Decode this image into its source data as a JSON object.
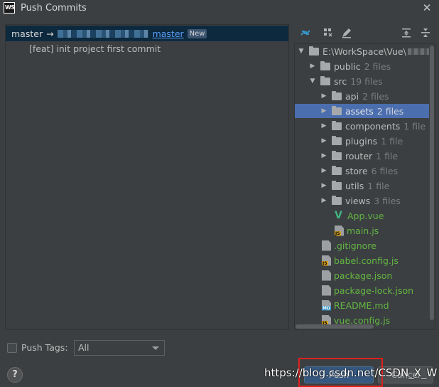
{
  "window": {
    "app_icon": "WS",
    "title": "Push Commits",
    "close_glyph": "✕"
  },
  "commits": {
    "local_branch": "master",
    "arrow": "→",
    "remote_branch": "master",
    "new_badge": "New",
    "items": [
      "[feat] init project first commit"
    ]
  },
  "tree": {
    "root": "E:\\WorkSpace\\Vue\\",
    "rows": [
      {
        "name": "public",
        "count": "2 files"
      },
      {
        "name": "src",
        "count": "19 files"
      },
      {
        "name": "api",
        "count": "2 files"
      },
      {
        "name": "assets",
        "count": "2 files"
      },
      {
        "name": "components",
        "count": "1 file"
      },
      {
        "name": "plugins",
        "count": "1 file"
      },
      {
        "name": "router",
        "count": "1 file"
      },
      {
        "name": "store",
        "count": "6 files"
      },
      {
        "name": "utils",
        "count": "1 file"
      },
      {
        "name": "views",
        "count": "3 files"
      }
    ],
    "files": [
      {
        "name": "App.vue",
        "icon": "vue-icon"
      },
      {
        "name": "main.js",
        "icon": "js-file-icon"
      },
      {
        "name": ".gitignore",
        "icon": "gitignore-file-icon"
      },
      {
        "name": "babel.config.js",
        "icon": "js-file-icon"
      },
      {
        "name": "package.json",
        "icon": "config-file-icon"
      },
      {
        "name": "package-lock.json",
        "icon": "config-file-icon"
      },
      {
        "name": "README.md",
        "icon": "md-file-icon"
      },
      {
        "name": "vue.config.js",
        "icon": "js-file-icon"
      }
    ]
  },
  "footer": {
    "push_tags_label": "Push Tags:",
    "push_tags_value": "All",
    "help_label": "?",
    "push_label": "Push",
    "cancel_label": "Cancel"
  },
  "watermark": "https://blog.csdn.net/CSDN_X_W",
  "colors": {
    "selected_row": "#4b6eaf",
    "branch_row": "#0d293e",
    "vcs_added_green": "#62b543",
    "link_blue": "#589df6",
    "highlight_red": "#e0201f"
  }
}
